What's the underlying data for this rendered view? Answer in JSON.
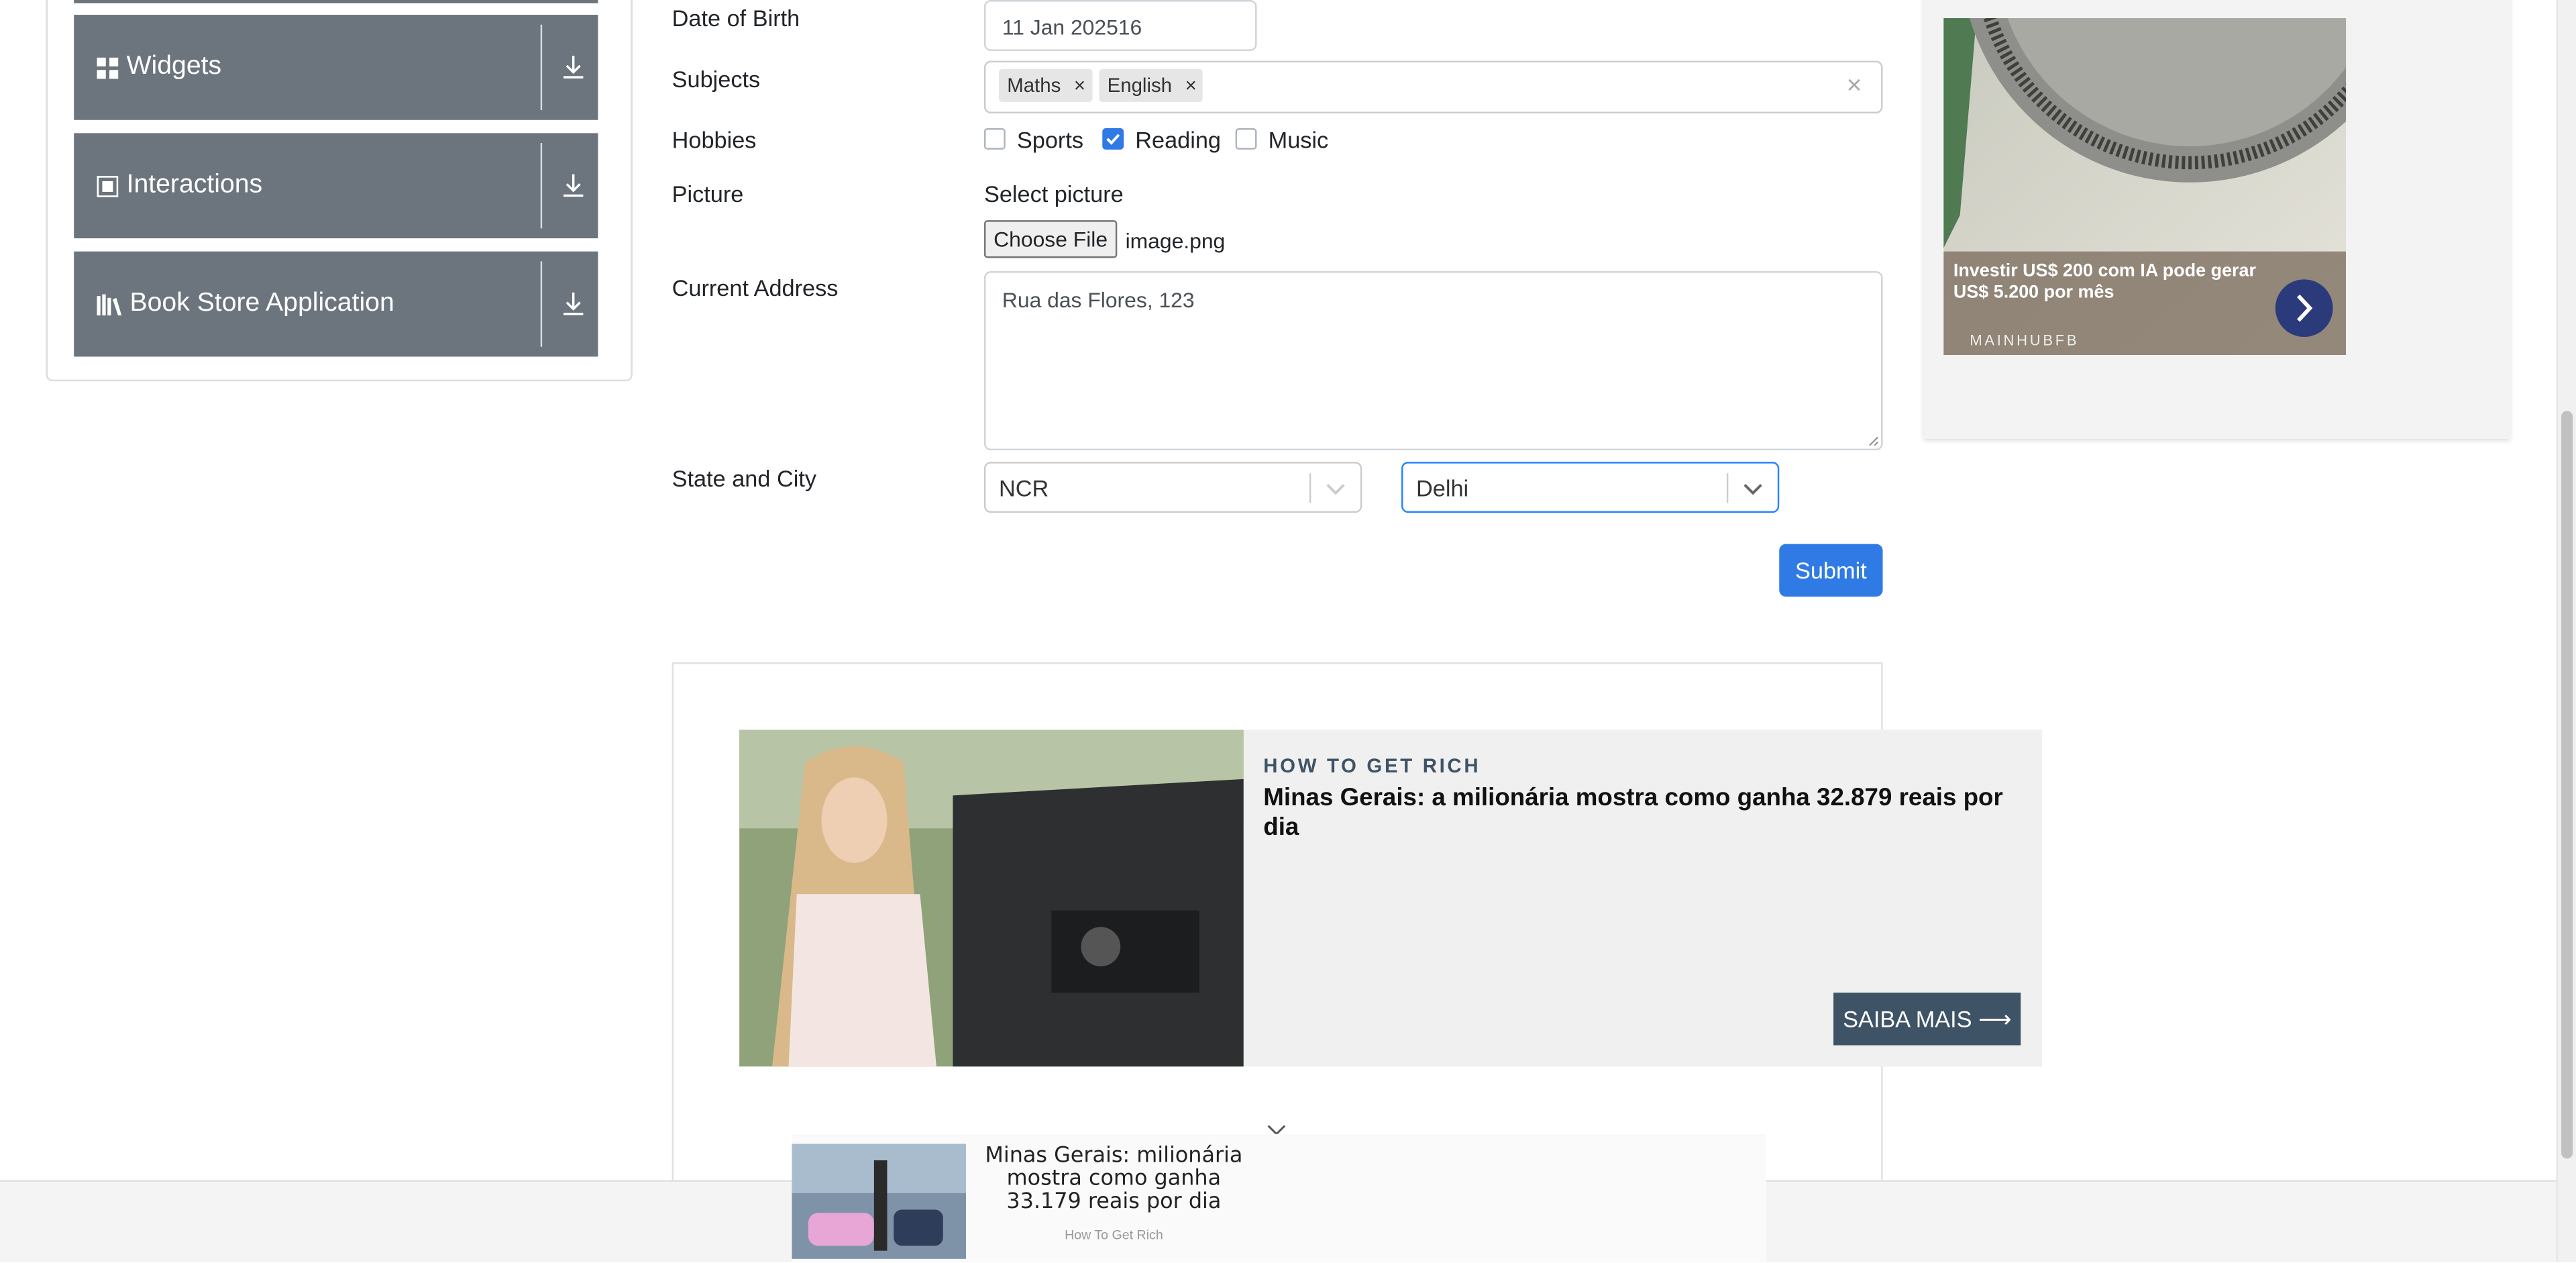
{
  "sidebar": {
    "groups": [
      {
        "label": "Widgets",
        "icon": "widgets-icon"
      },
      {
        "label": "Interactions",
        "icon": "interactions-icon"
      },
      {
        "label": "Book Store Application",
        "icon": "book-store-icon"
      }
    ]
  },
  "form": {
    "dob": {
      "label": "Date of Birth",
      "value": "11 Jan 202516"
    },
    "subjects": {
      "label": "Subjects",
      "chips": [
        "Maths",
        "English"
      ],
      "clear": "×",
      "chip_remove": "×"
    },
    "hobbies": {
      "label": "Hobbies",
      "options": [
        {
          "label": "Sports",
          "checked": false
        },
        {
          "label": "Reading",
          "checked": true
        },
        {
          "label": "Music",
          "checked": false
        }
      ]
    },
    "picture": {
      "label": "Picture",
      "select_label": "Select picture",
      "button": "Choose File",
      "file_name": "image.png"
    },
    "address": {
      "label": "Current Address",
      "value": "Rua das Flores, 123"
    },
    "state_city": {
      "label": "State and City",
      "state": "NCR",
      "city": "Delhi"
    },
    "submit": "Submit"
  },
  "right_ad": {
    "headline": "Investir US$ 200 com IA pode gerar US$ 5.200 por mês",
    "brand": "MAINHUBFB"
  },
  "main_ad": {
    "kicker": "HOW TO GET RICH",
    "headline": "Minas Gerais: a milionária mostra como ganha 32.879 reais por dia",
    "cta": "SAIBA MAIS ⟶"
  },
  "bottom_ad": {
    "headline": "Minas Gerais: milionária mostra como ganha 33.179 reais por dia",
    "source": "How To Get Rich"
  },
  "colors": {
    "sidebar": "#6c757d",
    "primary": "#2f7ae5",
    "cta": "#3f5366"
  }
}
